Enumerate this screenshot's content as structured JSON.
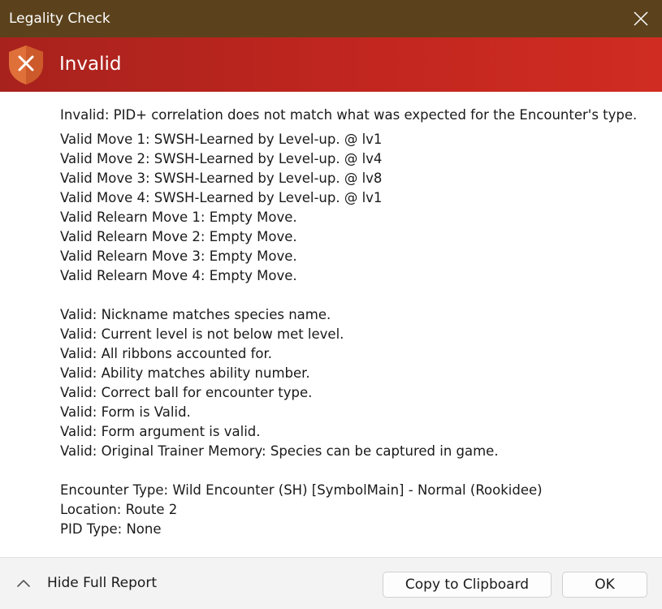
{
  "window": {
    "title": "Legality Check"
  },
  "banner": {
    "status": "Invalid",
    "icon": "shield-error-icon",
    "color": "#c1261f"
  },
  "report": {
    "summary": "Invalid: PID+ correlation does not match what was expected for the Encounter's type.",
    "moves": [
      "Valid Move 1: SWSH-Learned by Level-up. @ lv1",
      "Valid Move 2: SWSH-Learned by Level-up. @ lv4",
      "Valid Move 3: SWSH-Learned by Level-up. @ lv8",
      "Valid Move 4: SWSH-Learned by Level-up. @ lv1",
      "Valid Relearn Move 1: Empty Move.",
      "Valid Relearn Move 2: Empty Move.",
      "Valid Relearn Move 3: Empty Move.",
      "Valid Relearn Move 4: Empty Move."
    ],
    "checks": [
      "Valid: Nickname matches species name.",
      "Valid: Current level is not below met level.",
      "Valid: All ribbons accounted for.",
      "Valid: Ability matches ability number.",
      "Valid: Correct ball for encounter type.",
      "Valid: Form is Valid.",
      "Valid: Form argument is valid.",
      "Valid: Original Trainer Memory: Species can be captured in game."
    ],
    "encounter": [
      "Encounter Type: Wild Encounter (SH) [SymbolMain] - Normal (Rookidee)",
      "Location: Route 2",
      "PID Type: None"
    ]
  },
  "footer": {
    "expander_label": "Hide Full Report",
    "copy_label": "Copy to Clipboard",
    "ok_label": "OK"
  }
}
